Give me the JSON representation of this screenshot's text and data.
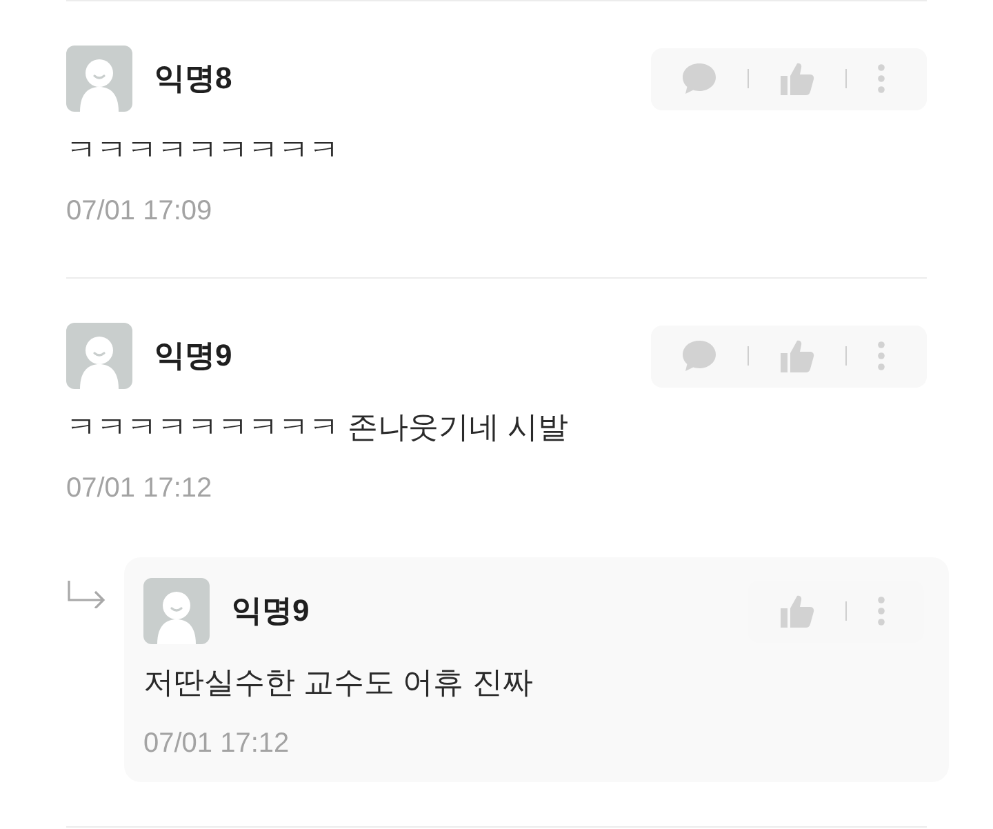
{
  "comments": [
    {
      "kind": "comment",
      "author": "익명8",
      "body": "ㅋㅋㅋㅋㅋㅋㅋㅋㅋ",
      "time": "07/01 17:09"
    },
    {
      "kind": "comment",
      "author": "익명9",
      "body": "ㅋㅋㅋㅋㅋㅋㅋㅋㅋ 존나웃기네 시발",
      "time": "07/01 17:12",
      "children": [
        {
          "kind": "reply",
          "author": "익명9",
          "body": "저딴실수한 교수도 어휴 진짜",
          "time": "07/01 17:12"
        }
      ]
    }
  ]
}
